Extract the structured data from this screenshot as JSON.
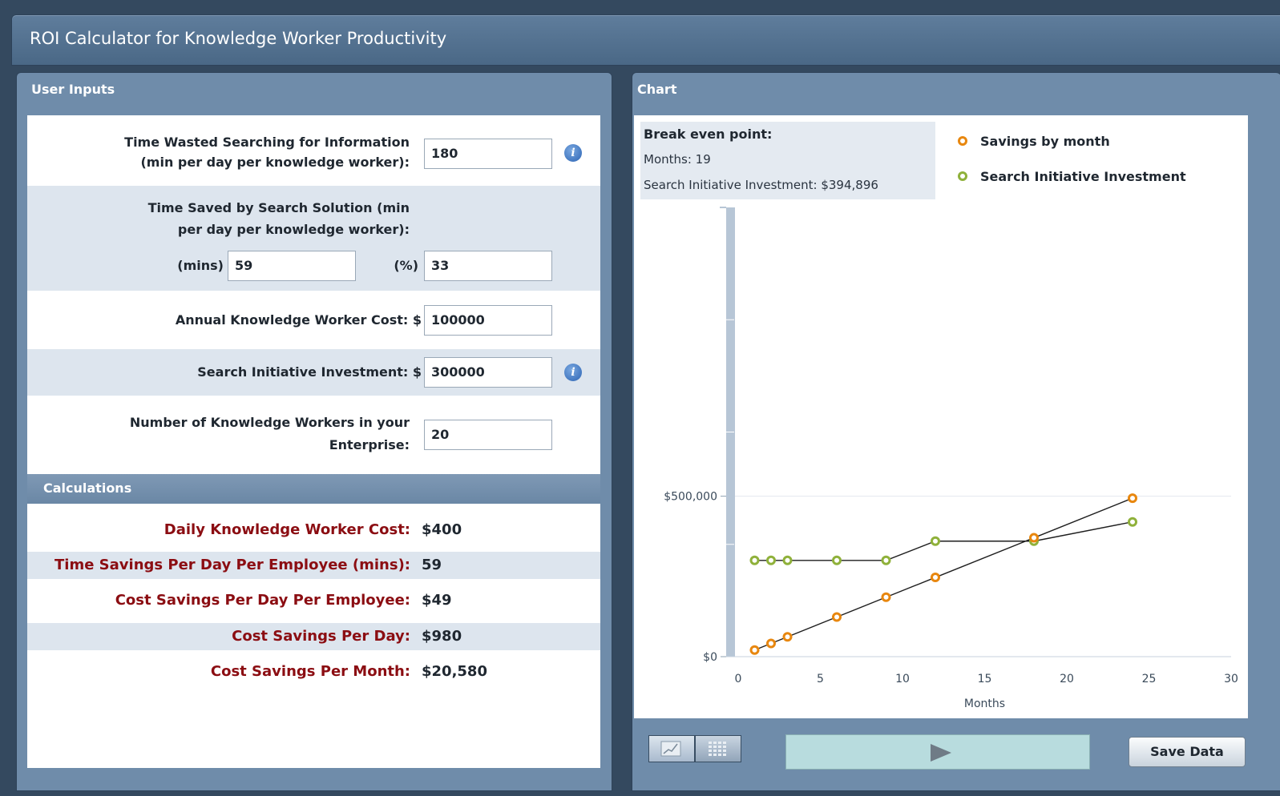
{
  "app": {
    "title": "ROI Calculator for Knowledge Worker Productivity"
  },
  "user_inputs": {
    "panel_title": "User Inputs",
    "time_wasted": {
      "label_line1": "Time Wasted Searching for Information",
      "label_line2": "(min per day per knowledge worker):",
      "value": "180"
    },
    "time_saved": {
      "label_line1": "Time Saved by Search Solution (min",
      "label_line2": "per day per knowledge worker):",
      "mins_label": "(mins)",
      "mins_value": "59",
      "pct_label": "(%)",
      "pct_value": "33"
    },
    "annual_cost": {
      "label": "Annual Knowledge Worker Cost:",
      "currency": "$",
      "value": "100000"
    },
    "investment": {
      "label": "Search Initiative Investment:",
      "currency": "$",
      "value": "300000"
    },
    "workers": {
      "label_line1": "Number of Knowledge Workers in your",
      "label_line2": "Enterprise:",
      "value": "20"
    },
    "info_glyph": "i"
  },
  "calculations": {
    "section_title": "Calculations",
    "rows": [
      {
        "label": "Daily Knowledge Worker Cost:",
        "value": "$400"
      },
      {
        "label": "Time Savings Per Day Per Employee (mins):",
        "value": "59"
      },
      {
        "label": "Cost Savings Per Day Per Employee:",
        "value": "$49"
      },
      {
        "label": "Cost Savings Per Day:",
        "value": "$980"
      },
      {
        "label": "Cost Savings Per Month:",
        "value": "$20,580"
      }
    ]
  },
  "chart_panel": {
    "panel_title": "Chart",
    "break_even": {
      "title": "Break even point:",
      "months_line": "Months: 19",
      "investment_line": "Search Initiative Investment: $394,896"
    },
    "save_label": "Save Data"
  },
  "colors": {
    "savings": "#e8870f",
    "investment": "#8fb13a"
  },
  "chart_data": {
    "type": "line",
    "xlabel": "Months",
    "ylabel": "",
    "xlim": [
      0,
      30
    ],
    "ylim": [
      0,
      1400000
    ],
    "x_ticks": [
      "0",
      "5",
      "10",
      "15",
      "20",
      "25",
      "30"
    ],
    "y_ticks": [
      "$0",
      "$500,000"
    ],
    "y_tick_values": [
      0,
      500000
    ],
    "grid": "horizontal",
    "legend": "top-right",
    "series": [
      {
        "name": "Savings by month",
        "points": [
          [
            1,
            20580
          ],
          [
            2,
            41160
          ],
          [
            3,
            61740
          ],
          [
            6,
            123480
          ],
          [
            9,
            185220
          ],
          [
            12,
            246960
          ],
          [
            18,
            370440
          ],
          [
            24,
            493920
          ]
        ]
      },
      {
        "name": "Search Initiative Investment",
        "points": [
          [
            1,
            300000
          ],
          [
            2,
            300000
          ],
          [
            3,
            300000
          ],
          [
            6,
            300000
          ],
          [
            9,
            300000
          ],
          [
            12,
            360000
          ],
          [
            18,
            360000
          ],
          [
            24,
            420000
          ]
        ]
      }
    ]
  }
}
